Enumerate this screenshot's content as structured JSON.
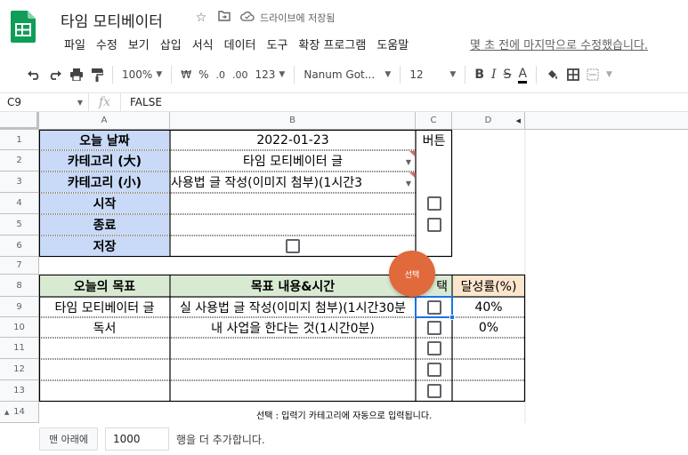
{
  "app": {
    "title": "타임 모티베이터",
    "save_status": "드라이브에 저장됨",
    "menu": [
      "파일",
      "수정",
      "보기",
      "삽입",
      "서식",
      "데이터",
      "도구",
      "확장 프로그램",
      "도움말"
    ],
    "last_edit": "몇 초 전에 마지막으로 수정했습니다.",
    "brand_color": "#0f9d58"
  },
  "toolbar": {
    "zoom": "100%",
    "currency": "₩",
    "percent": "%",
    "dec_less": ".0",
    "dec_more": ".00",
    "format_more": "123",
    "font": "Nanum Got...",
    "font_size": "12",
    "bold": "B",
    "italic": "I",
    "strike": "S",
    "text_color": "A"
  },
  "formula_bar": {
    "cell_ref": "C9",
    "fx": "fx",
    "value": "FALSE"
  },
  "grid": {
    "columns": [
      "A",
      "B",
      "C",
      "D"
    ],
    "rows": [
      "1",
      "2",
      "3",
      "4",
      "5",
      "6",
      "7",
      "8",
      "9",
      "10",
      "11",
      "12",
      "13",
      "14"
    ],
    "table1": {
      "r1": {
        "label": "오늘 날짜",
        "value": "2022-01-23",
        "c": "버튼"
      },
      "r2": {
        "label": "카테고리 (大)",
        "value": "타임 모티베이터 글"
      },
      "r3": {
        "label": "카테고리 (小)",
        "value": "사용법 글 작성(이미지 첨부)(1시간3"
      },
      "r4": {
        "label": "시작"
      },
      "r5": {
        "label": "종료"
      },
      "r6": {
        "label": "저장"
      }
    },
    "table2": {
      "headers": [
        "오늘의 목표",
        "목표 내용&시간",
        "택",
        "달성률(%)"
      ],
      "rows": [
        {
          "goal": "타임 모티베이터 글",
          "content": "실 사용법 글 작성(이미지 첨부)(1시간30분",
          "rate": "40%"
        },
        {
          "goal": "독서",
          "content": "내 사업을 한다는 것(1시간0분)",
          "rate": "0%"
        }
      ]
    },
    "note": "선택 : 입력기 카테고리에 자동으로 입력됩니다.",
    "tooltip": "선택"
  },
  "footer": {
    "add_button": "맨 아래에",
    "row_count": "1000",
    "add_text": "행을 더 추가합니다."
  }
}
